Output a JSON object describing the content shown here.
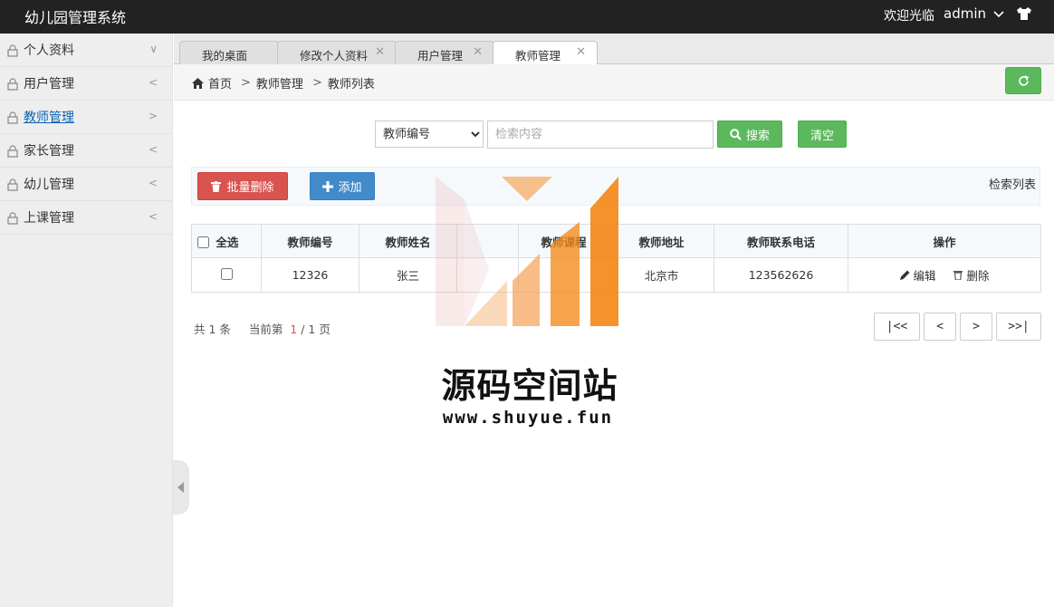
{
  "app": {
    "title": "幼儿园管理系统",
    "welcome": "欢迎光临",
    "username": "admin"
  },
  "sidebar": {
    "items": [
      {
        "label": "个人资料",
        "arrow": "∨"
      },
      {
        "label": "用户管理",
        "arrow": "<"
      },
      {
        "label": "教师管理",
        "arrow": ">"
      },
      {
        "label": "家长管理",
        "arrow": "<"
      },
      {
        "label": "幼儿管理",
        "arrow": "<"
      },
      {
        "label": "上课管理",
        "arrow": "<"
      }
    ],
    "active_index": 2
  },
  "tabs": [
    {
      "label": "我的桌面",
      "closable": false
    },
    {
      "label": "修改个人资料",
      "closable": true
    },
    {
      "label": "用户管理",
      "closable": true
    },
    {
      "label": "教师管理",
      "closable": true,
      "active": true
    }
  ],
  "breadcrumb": {
    "home": "首页",
    "level1": "教师管理",
    "level2": "教师列表",
    "separator": ">"
  },
  "search": {
    "field_selected": "教师编号",
    "placeholder": "检索内容",
    "search_label": "搜索",
    "clear_label": "清空"
  },
  "toolbar": {
    "batch_delete_label": "批量删除",
    "add_label": "添加",
    "list_label": "检索列表"
  },
  "table": {
    "select_all_label": "全选",
    "columns": [
      "教师编号",
      "教师姓名",
      "",
      "教师课程",
      "教师地址",
      "教师联系电话",
      "操作"
    ],
    "rows": [
      {
        "id": "12326",
        "name": "张三",
        "col3": "",
        "course": "",
        "address": "北京市",
        "phone": "123562626",
        "edit_label": "编辑",
        "delete_label": "删除"
      }
    ]
  },
  "pager": {
    "total_prefix": "共",
    "total": "1",
    "total_suffix": "条",
    "current_prefix": "当前第",
    "current": "1",
    "pages": "/ 1 页",
    "first": "|<<",
    "prev": "<",
    "next": ">",
    "last": ">>|"
  },
  "watermark": {
    "title": "源码空间站",
    "url": "www.shuyue.fun"
  },
  "colors": {
    "topbar": "#222222",
    "green": "#5cb85c",
    "danger": "#d9534f",
    "primary": "#428bca",
    "sidebar_active": "#0c64b4",
    "watermark_orange": "#f5891a"
  }
}
